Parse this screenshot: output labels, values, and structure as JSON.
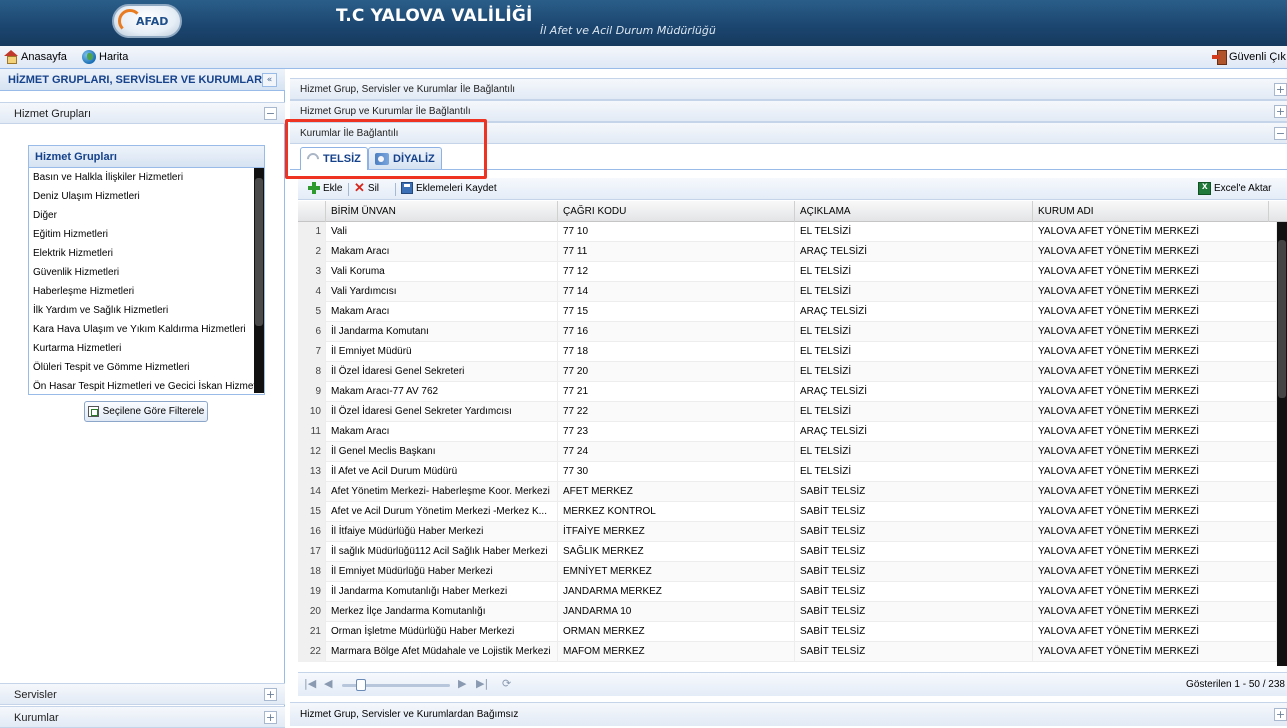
{
  "header": {
    "logo_text": "AFAD",
    "title": "T.C YALOVA VALİLİĞİ",
    "subtitle": "İl Afet ve Acil Durum Müdürlüğü"
  },
  "topbar": {
    "home": "Anasayfa",
    "map": "Harita",
    "logout": "Güvenli Çık"
  },
  "left": {
    "title": "HİZMET GRUPLARI, SERVİSLER VE KURUMLAR",
    "collapse_glyph": "«",
    "sections": [
      {
        "label": "Hizmet Grupları",
        "toggle": "−"
      },
      {
        "label": "Servisler",
        "toggle": "+"
      },
      {
        "label": "Kurumlar",
        "toggle": "+"
      }
    ],
    "hizmet_box_title": "Hizmet Grupları",
    "hizmet_items": [
      "Basın ve Halkla İlişkiler Hizmetleri",
      "Deniz Ulaşım Hizmetleri",
      "Diğer",
      "Eğitim Hizmetleri",
      "Elektrik Hizmetleri",
      "Güvenlik Hizmetleri",
      "Haberleşme Hizmetleri",
      "İlk Yardım ve Sağlık Hizmetleri",
      "Kara Hava Ulaşım ve Yıkım Kaldırma Hizmetleri",
      "Kurtarma Hizmetleri",
      "Ölüleri Tespit ve Gömme Hizmetleri",
      "Ön Hasar Tespit Hizmetleri ve Gecici İskan Hizmetleri"
    ],
    "filter_button": "Seçilene Göre Filterele"
  },
  "right": {
    "accordions": [
      {
        "label": "Hizmet Grup, Servisler ve Kurumlar İle Bağlantılı",
        "toggle": "+"
      },
      {
        "label": "Hizmet Grup ve Kurumlar İle Bağlantılı",
        "toggle": "+"
      },
      {
        "label": "Kurumlar İle Bağlantılı",
        "toggle": "−"
      }
    ],
    "tabs": [
      "TELSİZ",
      "DİYALİZ"
    ],
    "toolbar": {
      "add": "Ekle",
      "delete": "Sil",
      "save": "Eklemeleri Kaydet",
      "export": "Excel'e Aktar"
    },
    "columns": [
      "BİRİM ÜNVAN",
      "ÇAĞRI KODU",
      "AÇIKLAMA",
      "KURUM ADI"
    ],
    "rows": [
      [
        "1",
        "Vali",
        "77 10",
        "EL TELSİZİ",
        "YALOVA AFET YÖNETİM MERKEZİ"
      ],
      [
        "2",
        "Makam Aracı",
        "77 11",
        "ARAÇ TELSİZİ",
        "YALOVA AFET YÖNETİM MERKEZİ"
      ],
      [
        "3",
        "Vali Koruma",
        "77 12",
        "EL TELSİZİ",
        "YALOVA AFET YÖNETİM MERKEZİ"
      ],
      [
        "4",
        "Vali Yardımcısı",
        "77 14",
        "EL TELSİZİ",
        "YALOVA AFET YÖNETİM MERKEZİ"
      ],
      [
        "5",
        "Makam Aracı",
        "77 15",
        "ARAÇ TELSİZİ",
        "YALOVA AFET YÖNETİM MERKEZİ"
      ],
      [
        "6",
        "İl Jandarma Komutanı",
        "77 16",
        "EL TELSİZİ",
        "YALOVA AFET YÖNETİM MERKEZİ"
      ],
      [
        "7",
        "İl Emniyet Müdürü",
        "77 18",
        "EL TELSİZİ",
        "YALOVA AFET YÖNETİM MERKEZİ"
      ],
      [
        "8",
        "İl Özel İdaresi Genel Sekreteri",
        "77 20",
        "EL TELSİZİ",
        "YALOVA AFET YÖNETİM MERKEZİ"
      ],
      [
        "9",
        "Makam Aracı-77 AV 762",
        "77 21",
        "ARAÇ TELSİZİ",
        "YALOVA AFET YÖNETİM MERKEZİ"
      ],
      [
        "10",
        "İl Özel İdaresi Genel Sekreter Yardımcısı",
        "77 22",
        "EL TELSİZİ",
        "YALOVA AFET YÖNETİM MERKEZİ"
      ],
      [
        "11",
        "Makam Aracı",
        "77 23",
        "ARAÇ TELSİZİ",
        "YALOVA AFET YÖNETİM MERKEZİ"
      ],
      [
        "12",
        "İl Genel Meclis Başkanı",
        "77 24",
        "EL TELSİZİ",
        "YALOVA AFET YÖNETİM MERKEZİ"
      ],
      [
        "13",
        "İl Afet ve Acil Durum Müdürü",
        "77 30",
        "EL TELSİZİ",
        "YALOVA AFET YÖNETİM MERKEZİ"
      ],
      [
        "14",
        "Afet Yönetim Merkezi- Haberleşme Koor. Merkezi",
        "AFET MERKEZ",
        "SABİT TELSİZ",
        "YALOVA AFET YÖNETİM MERKEZİ"
      ],
      [
        "15",
        "Afet ve Acil Durum Yönetim Merkezi -Merkez K...",
        "MERKEZ KONTROL",
        "SABİT TELSİZ",
        "YALOVA AFET YÖNETİM MERKEZİ"
      ],
      [
        "16",
        "İl İtfaiye Müdürlüğü Haber Merkezi",
        "İTFAİYE MERKEZ",
        "SABİT TELSİZ",
        "YALOVA AFET YÖNETİM MERKEZİ"
      ],
      [
        "17",
        "İl sağlık Müdürlüğü112 Acil Sağlık Haber Merkezi",
        "SAĞLIK MERKEZ",
        "SABİT TELSİZ",
        "YALOVA AFET YÖNETİM MERKEZİ"
      ],
      [
        "18",
        "İl Emniyet Müdürlüğü Haber Merkezi",
        "EMNİYET MERKEZ",
        "SABİT TELSİZ",
        "YALOVA AFET YÖNETİM MERKEZİ"
      ],
      [
        "19",
        "İl Jandarma Komutanlığı Haber Merkezi",
        "JANDARMA MERKEZ",
        "SABİT TELSİZ",
        "YALOVA AFET YÖNETİM MERKEZİ"
      ],
      [
        "20",
        "Merkez İlçe Jandarma Komutanlığı",
        "JANDARMA 10",
        "SABİT TELSİZ",
        "YALOVA AFET YÖNETİM MERKEZİ"
      ],
      [
        "21",
        "Orman İşletme Müdürlüğü Haber Merkezi",
        "ORMAN MERKEZ",
        "SABİT TELSİZ",
        "YALOVA AFET YÖNETİM MERKEZİ"
      ],
      [
        "22",
        "Marmara Bölge Afet Müdahale ve Lojistik Merkezi",
        "MAFOM MERKEZ",
        "SABİT TELSİZ",
        "YALOVA AFET YÖNETİM MERKEZİ"
      ]
    ],
    "pager": {
      "info": "Gösterilen 1 - 50 / 238"
    },
    "bottom_accordion": {
      "label": "Hizmet Grup, Servisler ve Kurumlardan Bağımsız",
      "toggle": "+"
    }
  }
}
